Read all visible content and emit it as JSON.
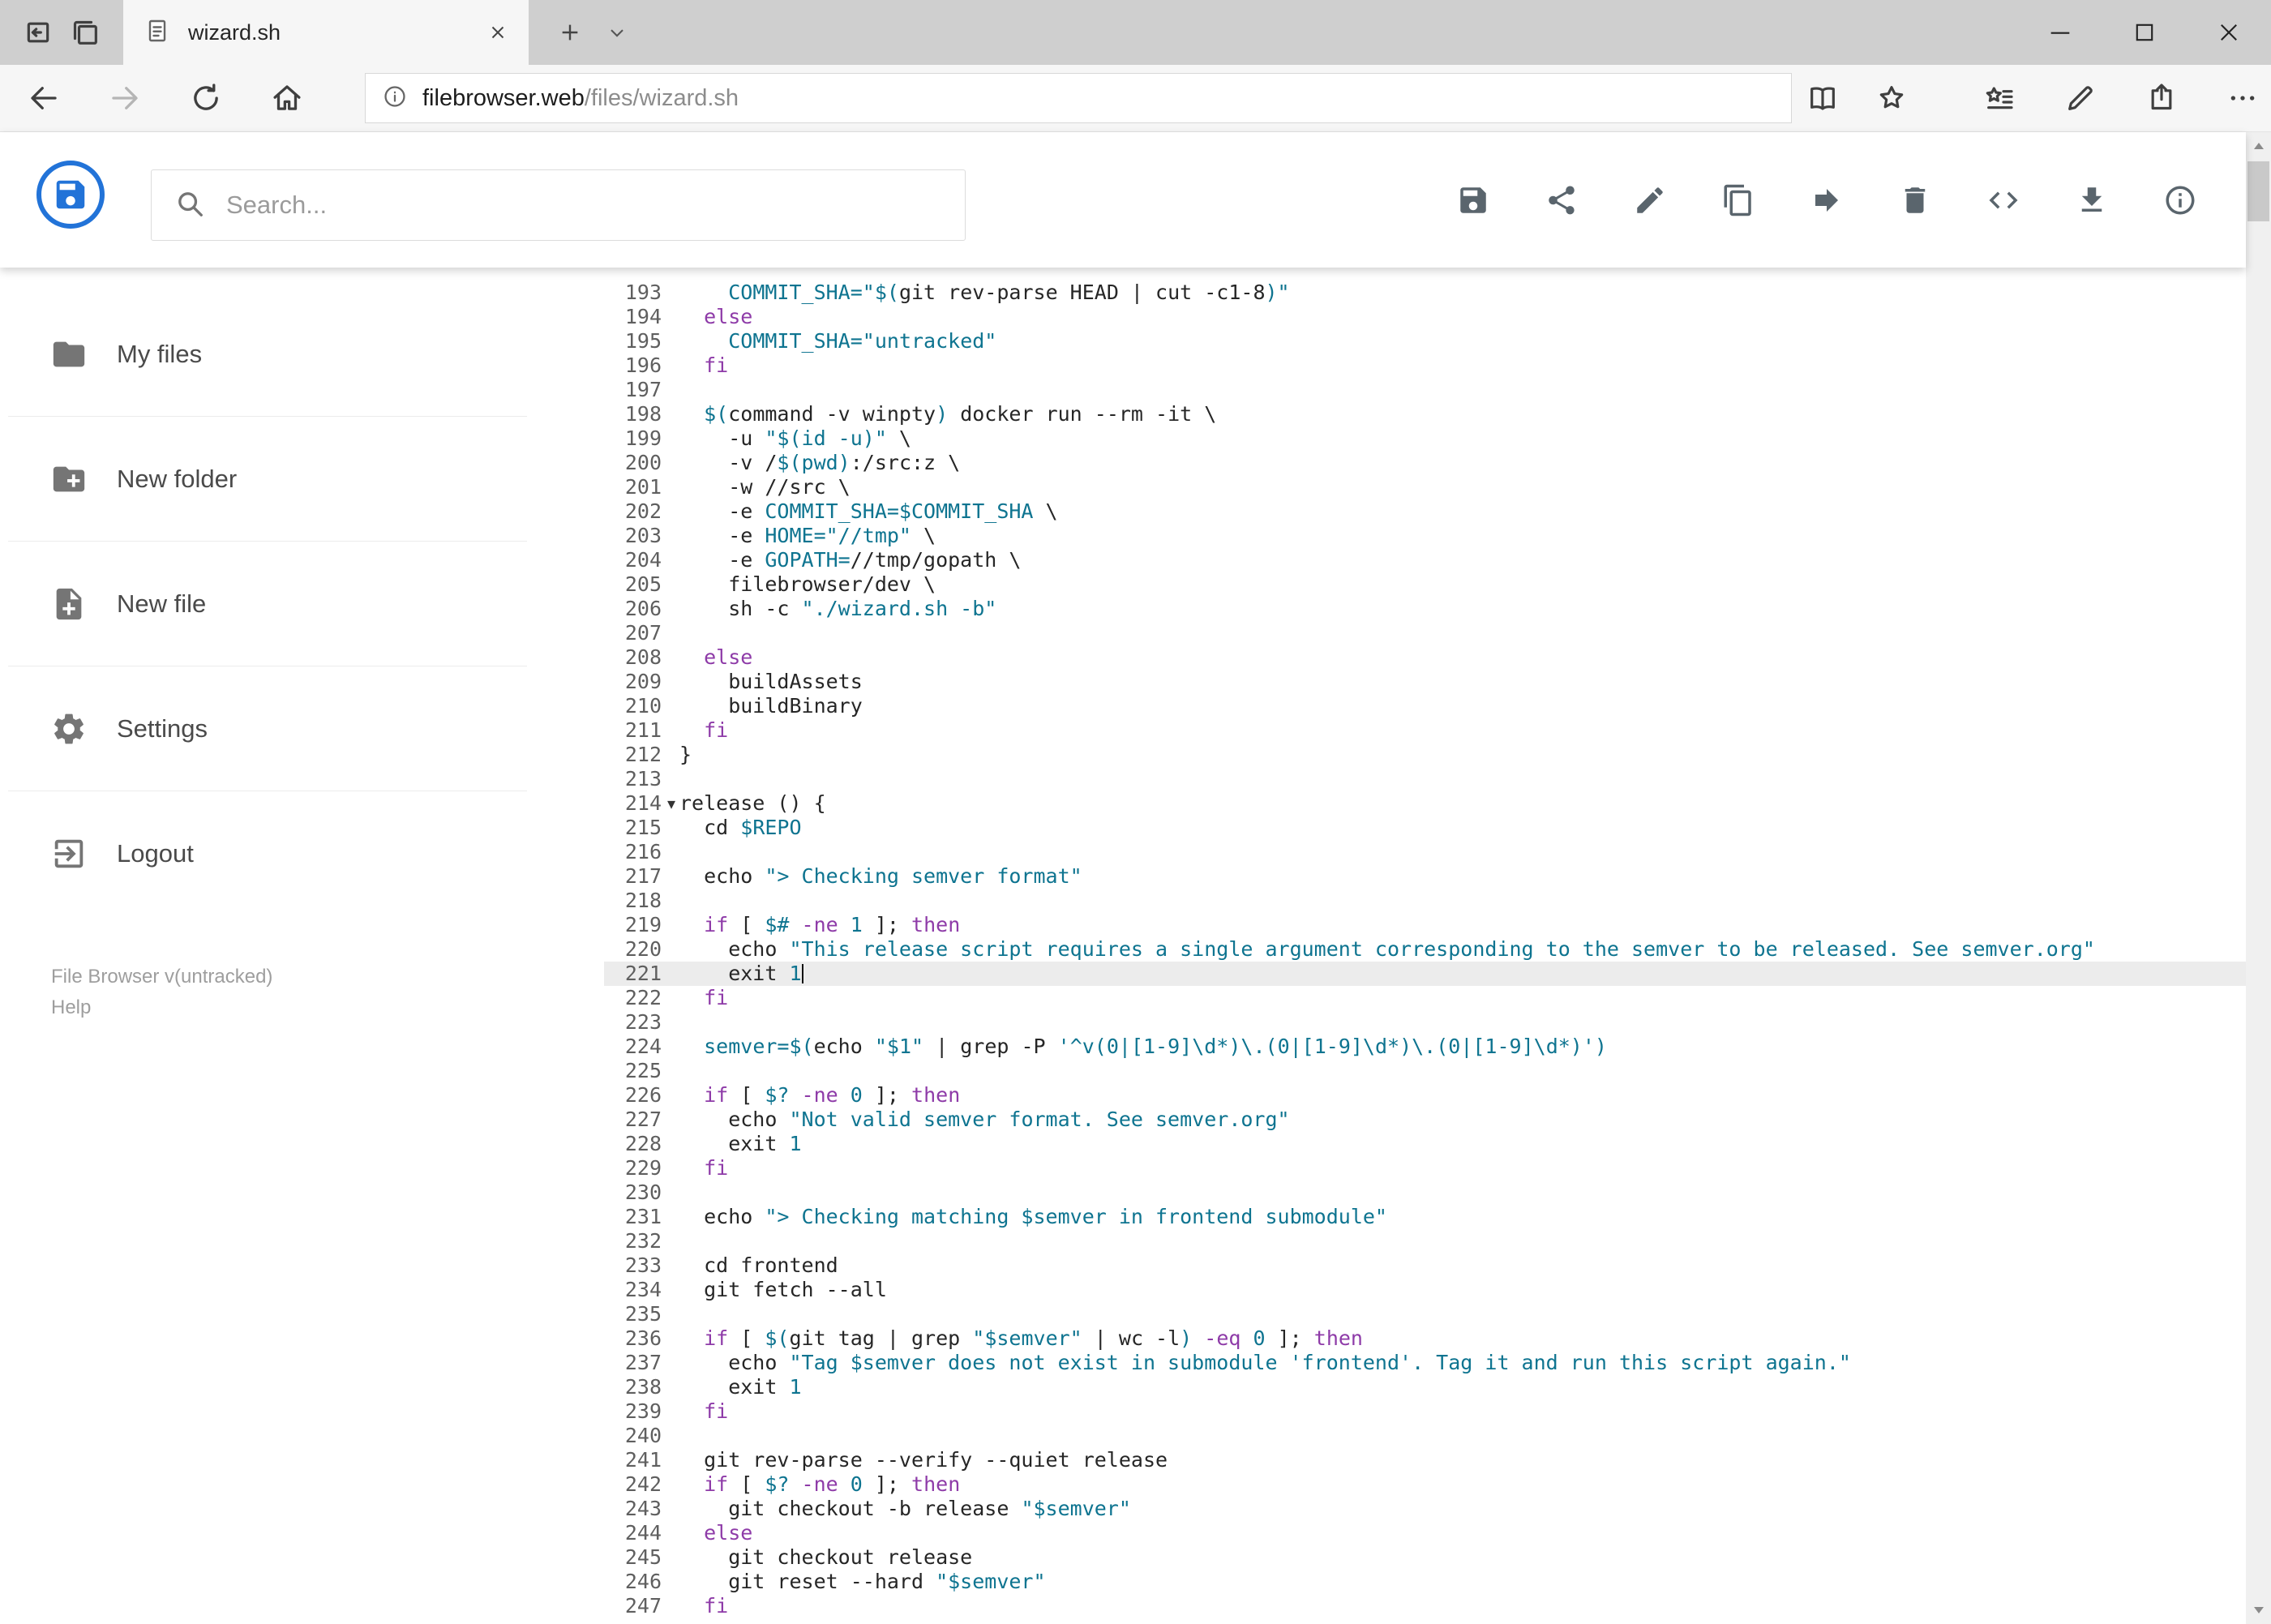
{
  "colors": {
    "brand": "#2273d8",
    "keyword": "#8e3ba8",
    "string": "#0e7490",
    "plain": "#262626",
    "active_line": "#ececec"
  },
  "browser": {
    "tab_title": "wizard.sh",
    "url_host": "filebrowser.web",
    "url_path": "/files/wizard.sh"
  },
  "header": {
    "search_placeholder": "Search...",
    "toolbar_icons": [
      "save",
      "share",
      "rename",
      "copy",
      "move",
      "delete",
      "raw",
      "download",
      "info"
    ]
  },
  "sidebar": {
    "items": [
      {
        "label": "My files",
        "icon": "folder"
      },
      {
        "label": "New folder",
        "icon": "folder-plus"
      },
      {
        "label": "New file",
        "icon": "file-plus"
      },
      {
        "label": "Settings",
        "icon": "gear"
      },
      {
        "label": "Logout",
        "icon": "logout"
      }
    ],
    "version": "File Browser v(untracked)",
    "help": "Help"
  },
  "editor": {
    "active_line": 221,
    "fold_line": 214,
    "cursor": {
      "line": 221,
      "col": 10
    },
    "lines": [
      {
        "n": 193,
        "s": [
          [
            "p",
            "    "
          ],
          [
            "t",
            "COMMIT_SHA="
          ],
          [
            "t",
            "\"$("
          ],
          [
            "p",
            "git rev-parse HEAD | cut -c1-8"
          ],
          [
            "t",
            ")\""
          ]
        ]
      },
      {
        "n": 194,
        "s": [
          [
            "p",
            "  "
          ],
          [
            "k",
            "else"
          ]
        ]
      },
      {
        "n": 195,
        "s": [
          [
            "p",
            "    "
          ],
          [
            "t",
            "COMMIT_SHA="
          ],
          [
            "t",
            "\"untracked\""
          ]
        ]
      },
      {
        "n": 196,
        "s": [
          [
            "p",
            "  "
          ],
          [
            "k",
            "fi"
          ]
        ]
      },
      {
        "n": 197,
        "s": []
      },
      {
        "n": 198,
        "s": [
          [
            "p",
            "  "
          ],
          [
            "t",
            "$("
          ],
          [
            "p",
            "command -v winpty"
          ],
          [
            "t",
            ")"
          ],
          [
            "p",
            " docker run --rm -it \\"
          ]
        ]
      },
      {
        "n": 199,
        "s": [
          [
            "p",
            "    -u "
          ],
          [
            "t",
            "\"$(id -u)\""
          ],
          [
            "p",
            " \\"
          ]
        ]
      },
      {
        "n": 200,
        "s": [
          [
            "p",
            "    -v /"
          ],
          [
            "t",
            "$(pwd)"
          ],
          [
            "p",
            ":/src:z \\"
          ]
        ]
      },
      {
        "n": 201,
        "s": [
          [
            "p",
            "    -w //src \\"
          ]
        ]
      },
      {
        "n": 202,
        "s": [
          [
            "p",
            "    -e "
          ],
          [
            "t",
            "COMMIT_SHA=$COMMIT_SHA"
          ],
          [
            "p",
            " \\"
          ]
        ]
      },
      {
        "n": 203,
        "s": [
          [
            "p",
            "    -e "
          ],
          [
            "t",
            "HOME="
          ],
          [
            "t",
            "\"//tmp\""
          ],
          [
            "p",
            " \\"
          ]
        ]
      },
      {
        "n": 204,
        "s": [
          [
            "p",
            "    -e "
          ],
          [
            "t",
            "GOPATH="
          ],
          [
            "p",
            "//tmp/gopath \\"
          ]
        ]
      },
      {
        "n": 205,
        "s": [
          [
            "p",
            "    filebrowser/dev \\"
          ]
        ]
      },
      {
        "n": 206,
        "s": [
          [
            "p",
            "    sh -c "
          ],
          [
            "t",
            "\"./wizard.sh -b\""
          ]
        ]
      },
      {
        "n": 207,
        "s": []
      },
      {
        "n": 208,
        "s": [
          [
            "p",
            "  "
          ],
          [
            "k",
            "else"
          ]
        ]
      },
      {
        "n": 209,
        "s": [
          [
            "p",
            "    buildAssets"
          ]
        ]
      },
      {
        "n": 210,
        "s": [
          [
            "p",
            "    buildBinary"
          ]
        ]
      },
      {
        "n": 211,
        "s": [
          [
            "p",
            "  "
          ],
          [
            "k",
            "fi"
          ]
        ]
      },
      {
        "n": 212,
        "s": [
          [
            "p",
            "}"
          ]
        ]
      },
      {
        "n": 213,
        "s": []
      },
      {
        "n": 214,
        "s": [
          [
            "p",
            "release () {"
          ]
        ]
      },
      {
        "n": 215,
        "s": [
          [
            "p",
            "  cd "
          ],
          [
            "t",
            "$REPO"
          ]
        ]
      },
      {
        "n": 216,
        "s": []
      },
      {
        "n": 217,
        "s": [
          [
            "p",
            "  echo "
          ],
          [
            "t",
            "\"> Checking semver format\""
          ]
        ]
      },
      {
        "n": 218,
        "s": []
      },
      {
        "n": 219,
        "s": [
          [
            "p",
            "  "
          ],
          [
            "k",
            "if"
          ],
          [
            "p",
            " [ "
          ],
          [
            "t",
            "$#"
          ],
          [
            "p",
            " "
          ],
          [
            "k",
            "-ne"
          ],
          [
            "p",
            " "
          ],
          [
            "t",
            "1"
          ],
          [
            "p",
            " ]; "
          ],
          [
            "k",
            "then"
          ]
        ]
      },
      {
        "n": 220,
        "s": [
          [
            "p",
            "    echo "
          ],
          [
            "t",
            "\"This release script requires a single argument corresponding to the semver to be released. See semver.org\""
          ]
        ]
      },
      {
        "n": 221,
        "s": [
          [
            "p",
            "    exit "
          ],
          [
            "t",
            "1"
          ]
        ]
      },
      {
        "n": 222,
        "s": [
          [
            "p",
            "  "
          ],
          [
            "k",
            "fi"
          ]
        ]
      },
      {
        "n": 223,
        "s": []
      },
      {
        "n": 224,
        "s": [
          [
            "p",
            "  "
          ],
          [
            "t",
            "semver=$("
          ],
          [
            "p",
            "echo "
          ],
          [
            "t",
            "\"$1\""
          ],
          [
            "p",
            " | grep -P "
          ],
          [
            "t",
            "'^v(0|[1-9]\\d*)\\.(0|[1-9]\\d*)\\.(0|[1-9]\\d*)'"
          ],
          [
            "t",
            ")"
          ]
        ]
      },
      {
        "n": 225,
        "s": []
      },
      {
        "n": 226,
        "s": [
          [
            "p",
            "  "
          ],
          [
            "k",
            "if"
          ],
          [
            "p",
            " [ "
          ],
          [
            "t",
            "$?"
          ],
          [
            "p",
            " "
          ],
          [
            "k",
            "-ne"
          ],
          [
            "p",
            " "
          ],
          [
            "t",
            "0"
          ],
          [
            "p",
            " ]; "
          ],
          [
            "k",
            "then"
          ]
        ]
      },
      {
        "n": 227,
        "s": [
          [
            "p",
            "    echo "
          ],
          [
            "t",
            "\"Not valid semver format. See semver.org\""
          ]
        ]
      },
      {
        "n": 228,
        "s": [
          [
            "p",
            "    exit "
          ],
          [
            "t",
            "1"
          ]
        ]
      },
      {
        "n": 229,
        "s": [
          [
            "p",
            "  "
          ],
          [
            "k",
            "fi"
          ]
        ]
      },
      {
        "n": 230,
        "s": []
      },
      {
        "n": 231,
        "s": [
          [
            "p",
            "  echo "
          ],
          [
            "t",
            "\"> Checking matching $semver in frontend submodule\""
          ]
        ]
      },
      {
        "n": 232,
        "s": []
      },
      {
        "n": 233,
        "s": [
          [
            "p",
            "  cd frontend"
          ]
        ]
      },
      {
        "n": 234,
        "s": [
          [
            "p",
            "  git fetch --all"
          ]
        ]
      },
      {
        "n": 235,
        "s": []
      },
      {
        "n": 236,
        "s": [
          [
            "p",
            "  "
          ],
          [
            "k",
            "if"
          ],
          [
            "p",
            " [ "
          ],
          [
            "t",
            "$("
          ],
          [
            "p",
            "git tag | grep "
          ],
          [
            "t",
            "\"$semver\""
          ],
          [
            "p",
            " | wc -l"
          ],
          [
            "t",
            ")"
          ],
          [
            "p",
            " "
          ],
          [
            "k",
            "-eq"
          ],
          [
            "p",
            " "
          ],
          [
            "t",
            "0"
          ],
          [
            "p",
            " ]; "
          ],
          [
            "k",
            "then"
          ]
        ]
      },
      {
        "n": 237,
        "s": [
          [
            "p",
            "    echo "
          ],
          [
            "t",
            "\"Tag $semver does not exist in submodule 'frontend'. Tag it and run this script again.\""
          ]
        ]
      },
      {
        "n": 238,
        "s": [
          [
            "p",
            "    exit "
          ],
          [
            "t",
            "1"
          ]
        ]
      },
      {
        "n": 239,
        "s": [
          [
            "p",
            "  "
          ],
          [
            "k",
            "fi"
          ]
        ]
      },
      {
        "n": 240,
        "s": []
      },
      {
        "n": 241,
        "s": [
          [
            "p",
            "  git rev-parse --verify --quiet release"
          ]
        ]
      },
      {
        "n": 242,
        "s": [
          [
            "p",
            "  "
          ],
          [
            "k",
            "if"
          ],
          [
            "p",
            " [ "
          ],
          [
            "t",
            "$?"
          ],
          [
            "p",
            " "
          ],
          [
            "k",
            "-ne"
          ],
          [
            "p",
            " "
          ],
          [
            "t",
            "0"
          ],
          [
            "p",
            " ]; "
          ],
          [
            "k",
            "then"
          ]
        ]
      },
      {
        "n": 243,
        "s": [
          [
            "p",
            "    git checkout -b release "
          ],
          [
            "t",
            "\"$semver\""
          ]
        ]
      },
      {
        "n": 244,
        "s": [
          [
            "p",
            "  "
          ],
          [
            "k",
            "else"
          ]
        ]
      },
      {
        "n": 245,
        "s": [
          [
            "p",
            "    git checkout release"
          ]
        ]
      },
      {
        "n": 246,
        "s": [
          [
            "p",
            "    git reset --hard "
          ],
          [
            "t",
            "\"$semver\""
          ]
        ]
      },
      {
        "n": 247,
        "s": [
          [
            "p",
            "  "
          ],
          [
            "k",
            "fi"
          ]
        ]
      }
    ]
  }
}
